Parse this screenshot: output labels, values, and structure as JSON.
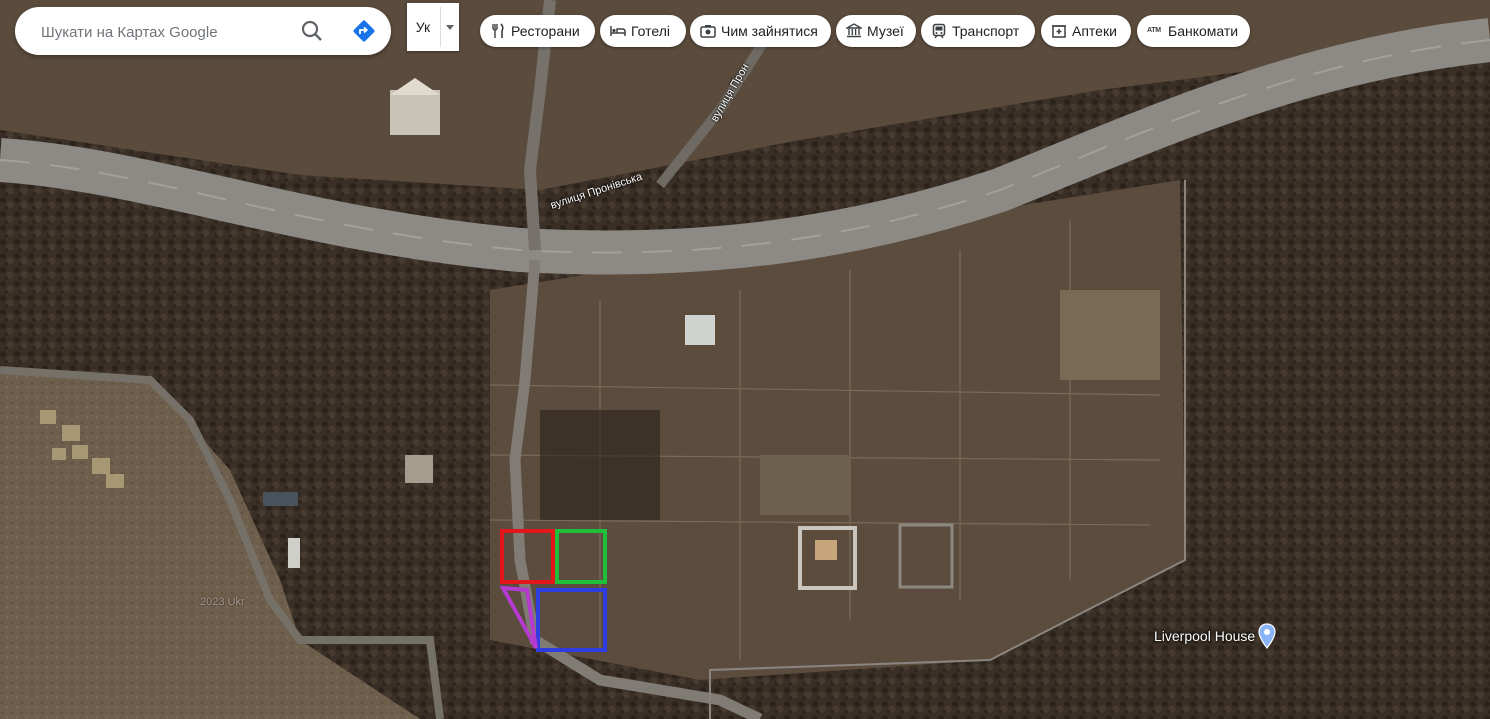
{
  "search": {
    "placeholder": "Шукати на Картах Google"
  },
  "layer_toggle": {
    "label": "Ук"
  },
  "chips": [
    {
      "label": "Ресторани",
      "icon": "fork-knife-icon"
    },
    {
      "label": "Готелі",
      "icon": "bed-icon"
    },
    {
      "label": "Чим зайнятися",
      "icon": "camera-icon"
    },
    {
      "label": "Музеї",
      "icon": "museum-icon"
    },
    {
      "label": "Транспорт",
      "icon": "train-icon"
    },
    {
      "label": "Аптеки",
      "icon": "pharmacy-icon"
    },
    {
      "label": "Банкомати",
      "icon": "atm-icon"
    }
  ],
  "place_marker": {
    "label": "Liverpool House"
  },
  "streets": {
    "main": "вулиця Пронівська",
    "branch": "вулиця Прон"
  },
  "watermark": "2023 Ukr",
  "overlay_colors": {
    "red": "#e3161b",
    "green": "#1fbf3a",
    "blue": "#2e3ce0",
    "purple": "#b43ad0"
  }
}
